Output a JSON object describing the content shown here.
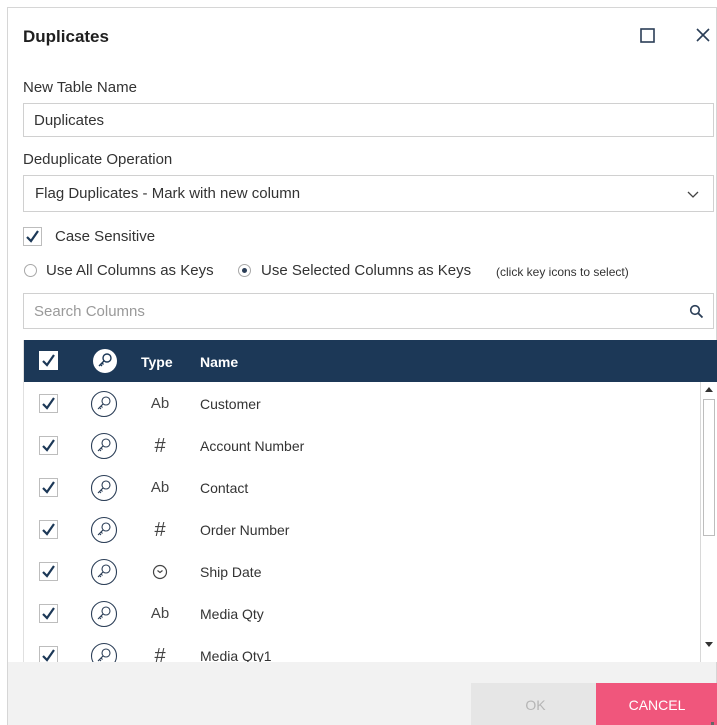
{
  "dialog": {
    "title": "Duplicates",
    "maximize_icon": "maximize-icon",
    "close_icon": "close-icon"
  },
  "table_name": {
    "label": "New Table Name",
    "value": "Duplicates"
  },
  "dedup_operation": {
    "label": "Deduplicate Operation",
    "selected": "Flag Duplicates - Mark with new column"
  },
  "case_sensitive": {
    "label": "Case Sensitive",
    "checked": true
  },
  "key_mode": {
    "options": [
      {
        "label": "Use All Columns as Keys",
        "selected": false
      },
      {
        "label": "Use Selected Columns as Keys",
        "selected": true
      }
    ],
    "hint": "(click key icons to select)"
  },
  "search": {
    "placeholder": "Search Columns"
  },
  "grid": {
    "headers": {
      "type": "Type",
      "name": "Name"
    },
    "rows": [
      {
        "checked": true,
        "type": "Ab",
        "name": "Customer"
      },
      {
        "checked": true,
        "type": "#",
        "name": "Account Number"
      },
      {
        "checked": true,
        "type": "Ab",
        "name": "Contact"
      },
      {
        "checked": true,
        "type": "#",
        "name": "Order Number"
      },
      {
        "checked": true,
        "type": "clock-icon",
        "name": "Ship Date"
      },
      {
        "checked": true,
        "type": "Ab",
        "name": "Media Qty"
      },
      {
        "checked": true,
        "type": "#",
        "name": "Media Qty1"
      }
    ]
  },
  "footer": {
    "ok_label": "OK",
    "cancel_label": "CANCEL"
  },
  "colors": {
    "header_bg": "#1c3857",
    "check_color": "#1c3857",
    "cancel_bg": "#f0567c",
    "ok_disabled_bg": "#e6e6e6"
  }
}
